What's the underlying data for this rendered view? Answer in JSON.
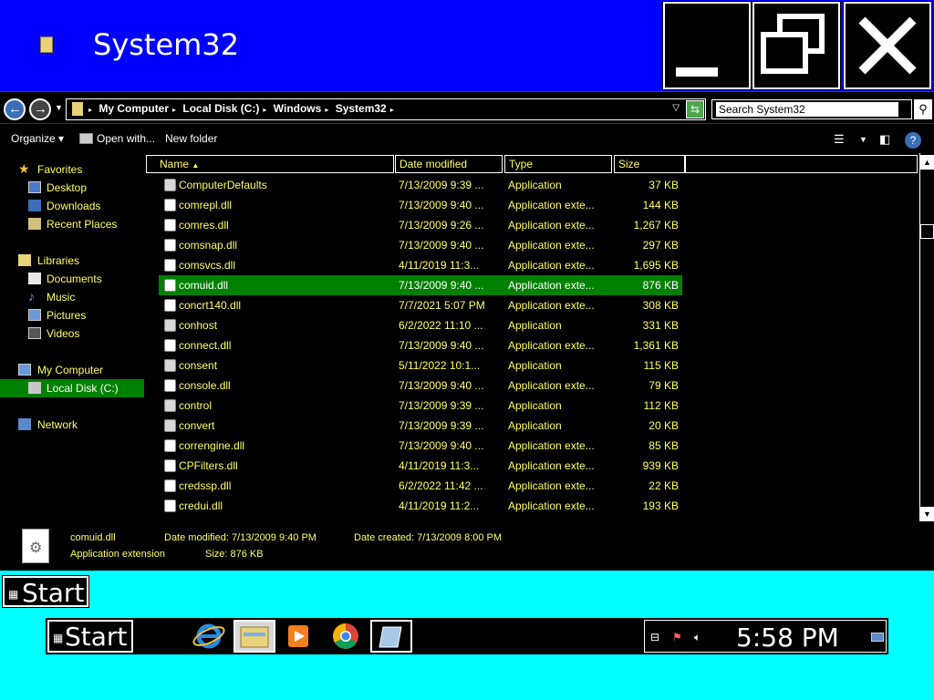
{
  "window": {
    "title": "System32",
    "minimize_icon": "minimize-icon",
    "maximize_icon": "restore-icon",
    "close_icon": "close-icon"
  },
  "address": {
    "crumbs": [
      "My Computer",
      "Local Disk (C:)",
      "Windows",
      "System32"
    ],
    "search_placeholder": "Search System32"
  },
  "toolbar": {
    "organize": "Organize",
    "open_with": "Open with...",
    "new_folder": "New folder"
  },
  "nav": {
    "favorites": "Favorites",
    "desktop": "Desktop",
    "downloads": "Downloads",
    "recent_places": "Recent Places",
    "libraries": "Libraries",
    "documents": "Documents",
    "music": "Music",
    "pictures": "Pictures",
    "videos": "Videos",
    "my_computer": "My Computer",
    "local_disk": "Local Disk (C:)",
    "network": "Network"
  },
  "columns": {
    "name": "Name",
    "date": "Date modified",
    "type": "Type",
    "size": "Size"
  },
  "files": [
    {
      "name": "ComputerDefaults",
      "date": "7/13/2009 9:39 ...",
      "type": "Application",
      "size": "37 KB"
    },
    {
      "name": "comrepl.dll",
      "date": "7/13/2009 9:40 ...",
      "type": "Application exte...",
      "size": "144 KB"
    },
    {
      "name": "comres.dll",
      "date": "7/13/2009 9:26 ...",
      "type": "Application exte...",
      "size": "1,267 KB"
    },
    {
      "name": "comsnap.dll",
      "date": "7/13/2009 9:40 ...",
      "type": "Application exte...",
      "size": "297 KB"
    },
    {
      "name": "comsvcs.dll",
      "date": "4/11/2019 11:3...",
      "type": "Application exte...",
      "size": "1,695 KB"
    },
    {
      "name": "comuid.dll",
      "date": "7/13/2009 9:40 ...",
      "type": "Application exte...",
      "size": "876 KB"
    },
    {
      "name": "concrt140.dll",
      "date": "7/7/2021 5:07 PM",
      "type": "Application exte...",
      "size": "308 KB"
    },
    {
      "name": "conhost",
      "date": "6/2/2022 11:10 ...",
      "type": "Application",
      "size": "331 KB"
    },
    {
      "name": "connect.dll",
      "date": "7/13/2009 9:40 ...",
      "type": "Application exte...",
      "size": "1,361 KB"
    },
    {
      "name": "consent",
      "date": "5/11/2022 10:1...",
      "type": "Application",
      "size": "115 KB"
    },
    {
      "name": "console.dll",
      "date": "7/13/2009 9:40 ...",
      "type": "Application exte...",
      "size": "79 KB"
    },
    {
      "name": "control",
      "date": "7/13/2009 9:39 ...",
      "type": "Application",
      "size": "112 KB"
    },
    {
      "name": "convert",
      "date": "7/13/2009 9:39 ...",
      "type": "Application",
      "size": "20 KB"
    },
    {
      "name": "correngine.dll",
      "date": "7/13/2009 9:40 ...",
      "type": "Application exte...",
      "size": "85 KB"
    },
    {
      "name": "CPFilters.dll",
      "date": "4/11/2019 11:3...",
      "type": "Application exte...",
      "size": "939 KB"
    },
    {
      "name": "credssp.dll",
      "date": "6/2/2022 11:42 ...",
      "type": "Application exte...",
      "size": "22 KB"
    },
    {
      "name": "credui.dll",
      "date": "4/11/2019 11:2...",
      "type": "Application exte...",
      "size": "193 KB"
    }
  ],
  "details": {
    "name": "comuid.dll",
    "type": "Application extension",
    "date_modified": "Date modified: 7/13/2009 9:40 PM",
    "size": "Size: 876 KB",
    "date_created": "Date created: 7/13/2009 8:00 PM"
  },
  "taskbar": {
    "start": "Start",
    "start_top": "Start",
    "clock": "5:58 PM"
  },
  "colors": {
    "titlebar": "#0000ff",
    "desktop": "#00ffff",
    "text": "#ffff66",
    "selection": "#008000"
  }
}
